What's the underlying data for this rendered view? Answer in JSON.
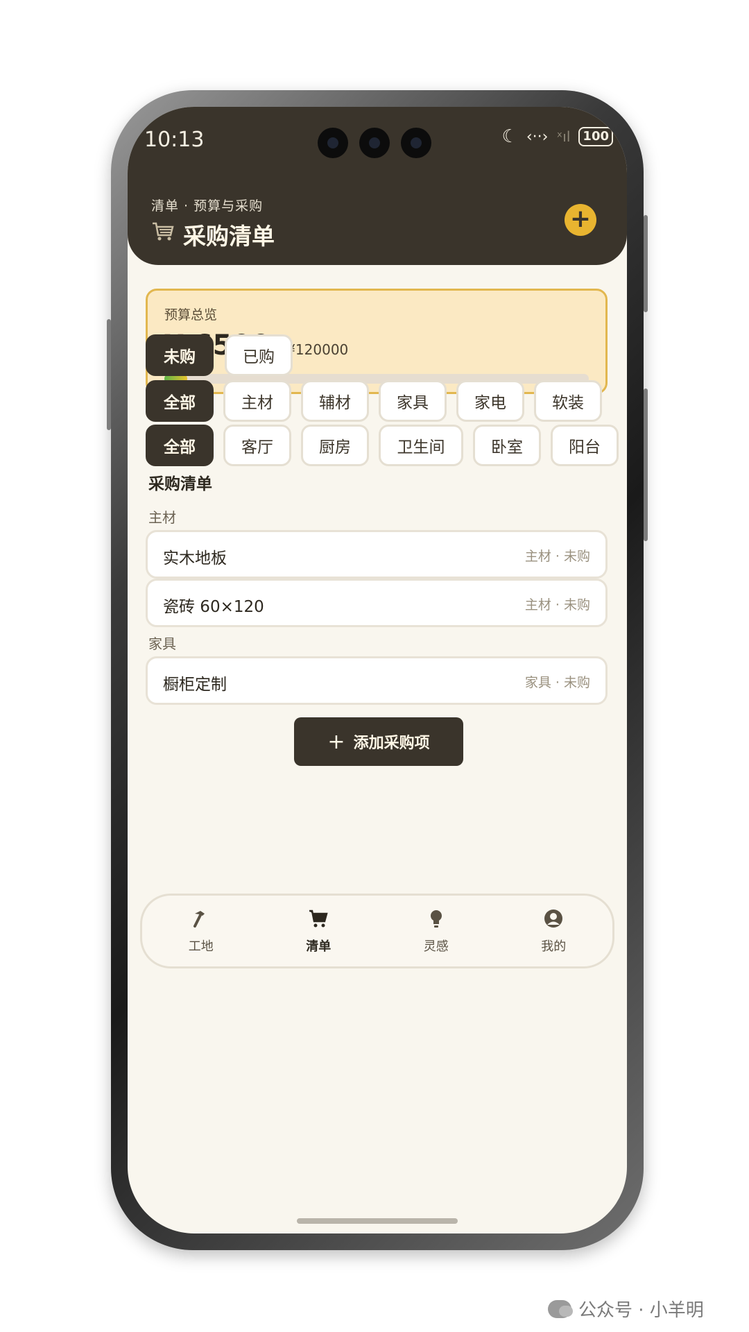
{
  "status_bar": {
    "time": "10:13",
    "battery": "100",
    "icons": [
      "moon-icon",
      "data-transfer-icon",
      "no-signal-icon",
      "battery-icon"
    ]
  },
  "header": {
    "breadcrumb": "清单 · 预算与采购",
    "title": "采购清单",
    "title_icon": "cart-icon",
    "add_icon": "plus-icon"
  },
  "budget": {
    "label": "预算总览",
    "spent": "¥ 6500",
    "total": "/ ¥120000",
    "progress_fraction": 0.054
  },
  "status_filters": [
    {
      "label": "未购",
      "active": true
    },
    {
      "label": "已购",
      "active": false
    }
  ],
  "category_filters": [
    {
      "label": "全部",
      "active": true
    },
    {
      "label": "主材",
      "active": false
    },
    {
      "label": "辅材",
      "active": false
    },
    {
      "label": "家具",
      "active": false
    },
    {
      "label": "家电",
      "active": false
    },
    {
      "label": "软装",
      "active": false
    }
  ],
  "room_filters": [
    {
      "label": "全部",
      "active": true
    },
    {
      "label": "客厅",
      "active": false
    },
    {
      "label": "厨房",
      "active": false
    },
    {
      "label": "卫生间",
      "active": false
    },
    {
      "label": "卧室",
      "active": false
    },
    {
      "label": "阳台",
      "active": false
    }
  ],
  "list": {
    "section_title": "采购清单",
    "groups": [
      {
        "label": "主材",
        "items": [
          {
            "name": "实木地板",
            "meta": "主材 · 未购"
          },
          {
            "name": "瓷砖 60×120",
            "meta": "主材 · 未购"
          }
        ]
      },
      {
        "label": "家具",
        "items": [
          {
            "name": "橱柜定制",
            "meta": "家具 · 未购"
          }
        ]
      }
    ]
  },
  "add_button": {
    "label": "添加采购项",
    "icon": "plus-icon"
  },
  "bottom_nav": [
    {
      "label": "工地",
      "icon": "hammer-icon",
      "active": false
    },
    {
      "label": "清单",
      "icon": "cart-icon",
      "active": true
    },
    {
      "label": "灵感",
      "icon": "lightbulb-icon",
      "active": false
    },
    {
      "label": "我的",
      "icon": "user-icon",
      "active": false
    }
  ],
  "watermark": {
    "text": "公众号 · 小羊明",
    "icon": "wechat-icon"
  },
  "colors": {
    "header_bg": "#3a342b",
    "screen_bg": "#f9f6ee",
    "accent": "#e8b430",
    "budget_card_bg": "#fbe9c3",
    "budget_card_border": "#e2b74f"
  }
}
